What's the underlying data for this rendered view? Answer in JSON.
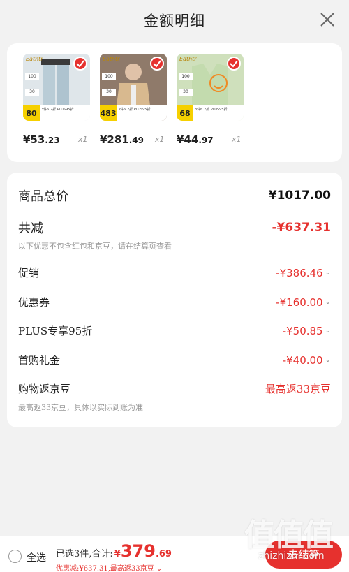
{
  "header": {
    "title": "金额明细",
    "close_icon": "close-icon"
  },
  "products": [
    {
      "image": "light-jeans-photo",
      "brand": "Eathtr",
      "tag_top": "100",
      "tag_bottom": "30",
      "badge_num": "80",
      "promo": "3件6.2折 PLUS95折",
      "price_int": "¥53",
      "price_dec": ".23",
      "qty": "x1",
      "bg": "#dfe6ea"
    },
    {
      "image": "khaki-jacket-photo",
      "brand": "Eathtr",
      "tag_top": "100",
      "tag_bottom": "30",
      "badge_num": "483",
      "promo": "3件6.2折 PLUS95折",
      "price_int": "¥281",
      "price_dec": ".49",
      "qty": "x1",
      "bg": "#b89a82"
    },
    {
      "image": "green-sweater-vest-photo",
      "brand": "Eathtr",
      "tag_top": "100",
      "tag_bottom": "30",
      "badge_num": "68",
      "promo": "3件6.2折 PLUS95折",
      "price_int": "¥44",
      "price_dec": ".97",
      "qty": "x1",
      "bg": "#cfe0bc"
    }
  ],
  "detail": {
    "total_label": "商品总价",
    "total_value": "¥1017.00",
    "reduce_label": "共减",
    "reduce_value": "-¥637.31",
    "reduce_note": "以下优惠不包含红包和京豆，请在结算页查看",
    "items": [
      {
        "label": "促销",
        "value": "-¥386.46"
      },
      {
        "label": "优惠券",
        "value": "-¥160.00"
      },
      {
        "label": "PLUS专享95折",
        "value": "-¥50.85"
      },
      {
        "label": "首购礼金",
        "value": "-¥40.00"
      }
    ],
    "jd_label": "购物返京豆",
    "jd_value": "最高返33京豆",
    "jd_note": "最高返33京豆，具体以实际到账为准"
  },
  "bottom": {
    "select_all": "全选",
    "selected_summary": "已选3件,合计:",
    "currency": "¥",
    "amount_int": "379",
    "amount_dec": ".69",
    "sub_summary": "优惠减:¥637.31,最高返33京豆",
    "checkout": "去结算"
  },
  "watermark": {
    "big": "值值值",
    "small": "zhizhizhi.com"
  },
  "colors": {
    "accent": "#e6312e",
    "background": "#f2f2f2",
    "card": "#ffffff"
  }
}
